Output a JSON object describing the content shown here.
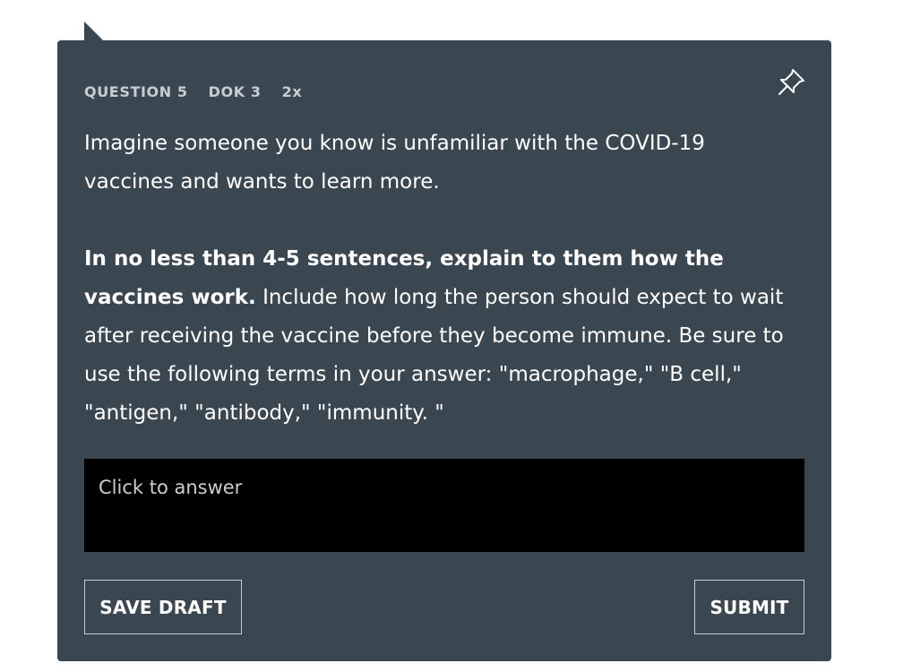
{
  "question": {
    "number_label": "QUESTION 5",
    "dok_label": "DOK 3",
    "weight_label": "2x"
  },
  "icons": {
    "pin": "pin-icon"
  },
  "prompt": {
    "intro": "Imagine someone you know is unfamiliar with the COVID-19 vaccines and wants to learn more.",
    "instruction_bold": "In no less than 4-5 sentences, explain to them how the vaccines work.",
    "instruction_rest": " Include how long the person should expect to wait after receiving the vaccine before they become immune. Be sure to use the following terms in your answer: \"macrophage,\" \"B cell,\" \"antigen,\" \"antibody,\" \"immunity. \""
  },
  "answer": {
    "placeholder": "Click to answer"
  },
  "actions": {
    "save_draft": "SAVE DRAFT",
    "submit": "SUBMIT"
  },
  "colors": {
    "card_background": "#3a4750",
    "answer_background": "#000000",
    "meta_text": "#c7ced3",
    "body_text": "#ffffff"
  }
}
